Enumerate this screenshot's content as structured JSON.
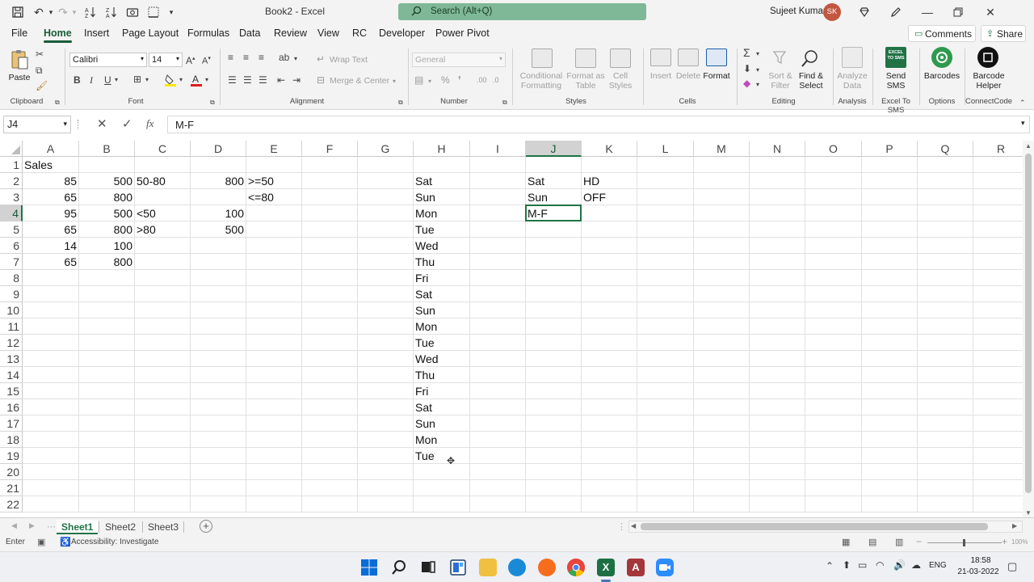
{
  "titlebar": {
    "doc_title": "Book2  -  Excel",
    "search_placeholder": "Search (Alt+Q)",
    "user_name": "Sujeet Kumar",
    "user_initials": "SK"
  },
  "menu": {
    "items": [
      "File",
      "Home",
      "Insert",
      "Page Layout",
      "Formulas",
      "Data",
      "Review",
      "View",
      "RC",
      "Developer",
      "Power Pivot"
    ],
    "active": "Home",
    "comments": "Comments",
    "share": "Share"
  },
  "ribbon": {
    "clipboard": {
      "paste": "Paste",
      "label": "Clipboard"
    },
    "font": {
      "name": "Calibri",
      "size": "14",
      "label": "Font"
    },
    "alignment": {
      "wrap": "Wrap Text",
      "merge": "Merge & Center",
      "label": "Alignment"
    },
    "number": {
      "format": "General",
      "label": "Number"
    },
    "styles": {
      "conditional": "Conditional Formatting",
      "format_as": "Format as Table",
      "cell_styles": "Cell Styles",
      "label": "Styles"
    },
    "cells": {
      "insert": "Insert",
      "delete": "Delete",
      "format": "Format",
      "label": "Cells"
    },
    "editing": {
      "sort": "Sort & Filter",
      "find": "Find & Select",
      "label": "Editing"
    },
    "analysis": {
      "analyze": "Analyze Data",
      "label": "Analysis"
    },
    "sms": {
      "send": "Send SMS",
      "label": "Excel To SMS",
      "badge": "EXCEL TO SMS"
    },
    "options": {
      "barcodes": "Barcodes",
      "label": "Options"
    },
    "connect": {
      "helper": "Barcode Helper",
      "label": "ConnectCode"
    }
  },
  "formula_bar": {
    "name_box": "J4",
    "fx": "fx",
    "formula": "M-F"
  },
  "grid": {
    "columns": [
      "A",
      "B",
      "C",
      "D",
      "E",
      "F",
      "G",
      "H",
      "I",
      "J",
      "K",
      "L",
      "M",
      "N",
      "O",
      "P",
      "Q",
      "R"
    ],
    "selected_column": "J",
    "rows": [
      "1",
      "2",
      "3",
      "4",
      "5",
      "6",
      "7",
      "8",
      "9",
      "10",
      "11",
      "12",
      "13",
      "14",
      "15",
      "16",
      "17",
      "18",
      "19",
      "20",
      "21",
      "22"
    ],
    "selected_row": "4",
    "cells": [
      {
        "ref": "A1",
        "value": "Sales",
        "type": "text"
      },
      {
        "ref": "A2",
        "value": "85",
        "type": "num"
      },
      {
        "ref": "B2",
        "value": "500",
        "type": "num"
      },
      {
        "ref": "C2",
        "value": "50-80",
        "type": "text"
      },
      {
        "ref": "D2",
        "value": "800",
        "type": "num"
      },
      {
        "ref": "E2",
        "value": ">=50",
        "type": "text"
      },
      {
        "ref": "H2",
        "value": "Sat",
        "type": "text"
      },
      {
        "ref": "J2",
        "value": "Sat",
        "type": "text"
      },
      {
        "ref": "K2",
        "value": "HD",
        "type": "text"
      },
      {
        "ref": "A3",
        "value": "65",
        "type": "num"
      },
      {
        "ref": "B3",
        "value": "800",
        "type": "num"
      },
      {
        "ref": "E3",
        "value": "<=80",
        "type": "text"
      },
      {
        "ref": "H3",
        "value": "Sun",
        "type": "text"
      },
      {
        "ref": "J3",
        "value": "Sun",
        "type": "text"
      },
      {
        "ref": "K3",
        "value": "OFF",
        "type": "text"
      },
      {
        "ref": "A4",
        "value": "95",
        "type": "num"
      },
      {
        "ref": "B4",
        "value": "500",
        "type": "num"
      },
      {
        "ref": "C4",
        "value": "<50",
        "type": "text"
      },
      {
        "ref": "D4",
        "value": "100",
        "type": "num"
      },
      {
        "ref": "H4",
        "value": "Mon",
        "type": "text"
      },
      {
        "ref": "J4",
        "value": "M-F",
        "type": "text"
      },
      {
        "ref": "A5",
        "value": "65",
        "type": "num"
      },
      {
        "ref": "B5",
        "value": "800",
        "type": "num"
      },
      {
        "ref": "C5",
        "value": ">80",
        "type": "text"
      },
      {
        "ref": "D5",
        "value": "500",
        "type": "num"
      },
      {
        "ref": "H5",
        "value": "Tue",
        "type": "text"
      },
      {
        "ref": "A6",
        "value": "14",
        "type": "num"
      },
      {
        "ref": "B6",
        "value": "100",
        "type": "num"
      },
      {
        "ref": "H6",
        "value": "Wed",
        "type": "text"
      },
      {
        "ref": "A7",
        "value": "65",
        "type": "num"
      },
      {
        "ref": "B7",
        "value": "800",
        "type": "num"
      },
      {
        "ref": "H7",
        "value": "Thu",
        "type": "text"
      },
      {
        "ref": "H8",
        "value": "Fri",
        "type": "text"
      },
      {
        "ref": "H9",
        "value": "Sat",
        "type": "text"
      },
      {
        "ref": "H10",
        "value": "Sun",
        "type": "text"
      },
      {
        "ref": "H11",
        "value": "Mon",
        "type": "text"
      },
      {
        "ref": "H12",
        "value": "Tue",
        "type": "text"
      },
      {
        "ref": "H13",
        "value": "Wed",
        "type": "text"
      },
      {
        "ref": "H14",
        "value": "Thu",
        "type": "text"
      },
      {
        "ref": "H15",
        "value": "Fri",
        "type": "text"
      },
      {
        "ref": "H16",
        "value": "Sat",
        "type": "text"
      },
      {
        "ref": "H17",
        "value": "Sun",
        "type": "text"
      },
      {
        "ref": "H18",
        "value": "Mon",
        "type": "text"
      },
      {
        "ref": "H19",
        "value": "Tue",
        "type": "text"
      }
    ],
    "active_cell": "J4"
  },
  "sheets": {
    "tabs": [
      "Sheet1",
      "Sheet2",
      "Sheet3"
    ],
    "active": "Sheet1"
  },
  "status": {
    "mode": "Enter",
    "accessibility": "Accessibility: Investigate",
    "zoom": "100%"
  },
  "taskbar": {
    "lang": "ENG",
    "time": "18:58",
    "date": "21-03-2022"
  },
  "colors": {
    "accent": "#217346",
    "search_bg": "#3c8a58"
  }
}
